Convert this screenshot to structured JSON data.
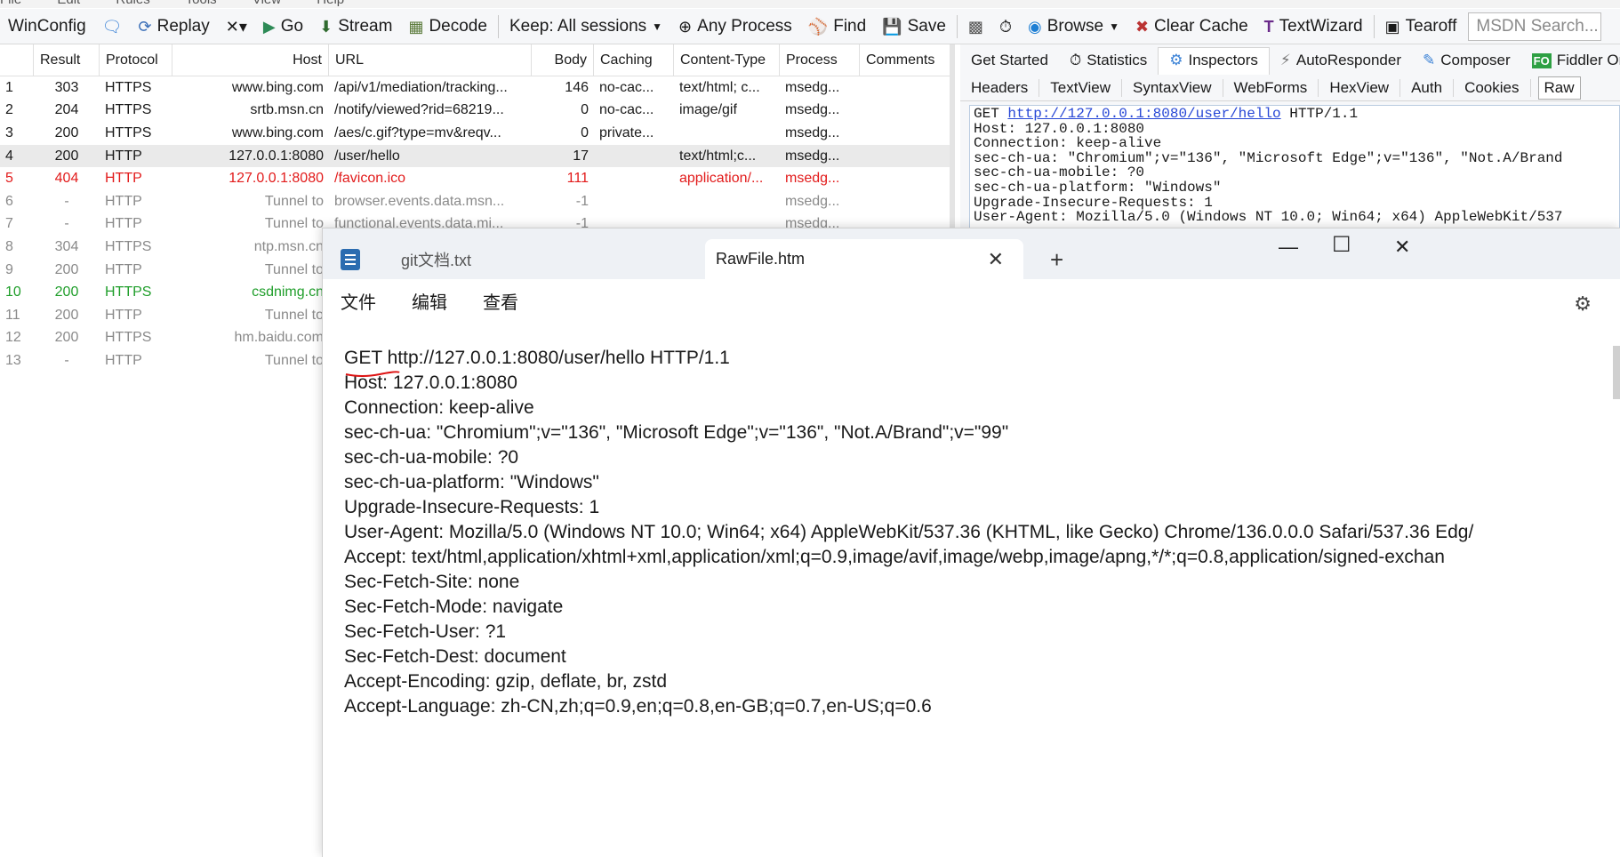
{
  "menubar": {
    "items": [
      "File",
      "Edit",
      "Rules",
      "Tools",
      "View",
      "Help"
    ]
  },
  "toolbar": {
    "winconfig": "WinConfig",
    "replay": "Replay",
    "go": "Go",
    "stream": "Stream",
    "decode": "Decode",
    "keep": "Keep: All sessions",
    "any_process": "Any Process",
    "find": "Find",
    "save": "Save",
    "browse": "Browse",
    "clear_cache": "Clear Cache",
    "textwizard": "TextWizard",
    "tearoff": "Tearoff",
    "msdn_placeholder": "MSDN Search..."
  },
  "grid": {
    "headers": [
      "",
      "Result",
      "Protocol",
      "Host",
      "URL",
      "Body",
      "Caching",
      "Content-Type",
      "Process",
      "Comments"
    ],
    "rows": [
      {
        "n": "1",
        "result": "303",
        "protocol": "HTTPS",
        "host": "www.bing.com",
        "url": "/api/v1/mediation/tracking...",
        "body": "146",
        "caching": "no-cac...",
        "ctype": "text/html; c...",
        "process": "msedg..."
      },
      {
        "n": "2",
        "result": "204",
        "protocol": "HTTPS",
        "host": "srtb.msn.cn",
        "url": "/notify/viewed?rid=68219...",
        "body": "0",
        "caching": "no-cac...",
        "ctype": "image/gif",
        "process": "msedg..."
      },
      {
        "n": "3",
        "result": "200",
        "protocol": "HTTPS",
        "host": "www.bing.com",
        "url": "/aes/c.gif?type=mv&reqv...",
        "body": "0",
        "caching": "private...",
        "ctype": "",
        "process": "msedg..."
      },
      {
        "n": "4",
        "result": "200",
        "protocol": "HTTP",
        "host": "127.0.0.1:8080",
        "url": "/user/hello",
        "body": "17",
        "caching": "",
        "ctype": "text/html;c...",
        "process": "msedg..."
      },
      {
        "n": "5",
        "result": "404",
        "protocol": "HTTP",
        "host": "127.0.0.1:8080",
        "url": "/favicon.ico",
        "body": "111",
        "caching": "",
        "ctype": "application/...",
        "process": "msedg..."
      },
      {
        "n": "6",
        "result": "-",
        "protocol": "HTTP",
        "host": "Tunnel to",
        "url": "browser.events.data.msn...",
        "body": "-1",
        "caching": "",
        "ctype": "",
        "process": "msedg..."
      },
      {
        "n": "7",
        "result": "-",
        "protocol": "HTTP",
        "host": "Tunnel to",
        "url": "functional.events.data.mi...",
        "body": "-1",
        "caching": "",
        "ctype": "",
        "process": "msedg..."
      },
      {
        "n": "8",
        "result": "304",
        "protocol": "HTTPS",
        "host": "ntp.msn.cn",
        "url": "",
        "body": "",
        "caching": "",
        "ctype": "",
        "process": ""
      },
      {
        "n": "9",
        "result": "200",
        "protocol": "HTTP",
        "host": "Tunnel to",
        "url": "",
        "body": "",
        "caching": "",
        "ctype": "",
        "process": ""
      },
      {
        "n": "10",
        "result": "200",
        "protocol": "HTTPS",
        "host": "csdnimg.cn",
        "url": "",
        "body": "",
        "caching": "",
        "ctype": "",
        "process": ""
      },
      {
        "n": "11",
        "result": "200",
        "protocol": "HTTP",
        "host": "Tunnel to",
        "url": "",
        "body": "",
        "caching": "",
        "ctype": "",
        "process": ""
      },
      {
        "n": "12",
        "result": "200",
        "protocol": "HTTPS",
        "host": "hm.baidu.com",
        "url": "",
        "body": "",
        "caching": "",
        "ctype": "",
        "process": ""
      },
      {
        "n": "13",
        "result": "-",
        "protocol": "HTTP",
        "host": "Tunnel to",
        "url": "",
        "body": "",
        "caching": "",
        "ctype": "",
        "process": ""
      }
    ]
  },
  "inspector": {
    "tabs": [
      "Get Started",
      "Statistics",
      "Inspectors",
      "AutoResponder",
      "Composer",
      "Fiddler Or"
    ],
    "subtabs": [
      "Headers",
      "TextView",
      "SyntaxView",
      "WebForms",
      "HexView",
      "Auth",
      "Cookies"
    ],
    "raw_label": "Raw",
    "raw_link": "http://127.0.0.1:8080/user/hello",
    "raw_lines": [
      "Host: 127.0.0.1:8080",
      "Connection: keep-alive",
      "sec-ch-ua: \"Chromium\";v=\"136\", \"Microsoft Edge\";v=\"136\", \"Not.A/Brand",
      "sec-ch-ua-mobile: ?0",
      "sec-ch-ua-platform: \"Windows\"",
      "Upgrade-Insecure-Requests: 1",
      "User-Agent: Mozilla/5.0 (Windows NT 10.0; Win64; x64) AppleWebKit/537"
    ]
  },
  "notepad": {
    "tab1": "git文档.txt",
    "tab2": "RawFile.htm",
    "menu": [
      "文件",
      "编辑",
      "查看"
    ],
    "lines": [
      "GET http://127.0.0.1:8080/user/hello HTTP/1.1",
      "Host: 127.0.0.1:8080",
      "Connection: keep-alive",
      "sec-ch-ua: \"Chromium\";v=\"136\", \"Microsoft Edge\";v=\"136\", \"Not.A/Brand\";v=\"99\"",
      "sec-ch-ua-mobile: ?0",
      "sec-ch-ua-platform: \"Windows\"",
      "Upgrade-Insecure-Requests: 1",
      "User-Agent: Mozilla/5.0 (Windows NT 10.0; Win64; x64) AppleWebKit/537.36 (KHTML, like Gecko) Chrome/136.0.0.0 Safari/537.36 Edg/",
      "Accept: text/html,application/xhtml+xml,application/xml;q=0.9,image/avif,image/webp,image/apng,*/*;q=0.8,application/signed-exchan",
      "Sec-Fetch-Site: none",
      "Sec-Fetch-Mode: navigate",
      "Sec-Fetch-User: ?1",
      "Sec-Fetch-Dest: document",
      "Accept-Encoding: gzip, deflate, br, zstd",
      "Accept-Language: zh-CN,zh;q=0.9,en;q=0.8,en-GB;q=0.7,en-US;q=0.6"
    ]
  }
}
